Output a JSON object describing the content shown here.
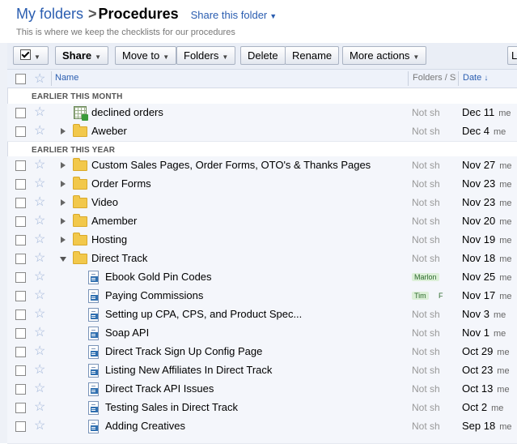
{
  "header": {
    "breadcrumb_root": "My folders",
    "separator": ">",
    "current_folder": "Procedures",
    "share_folder_label": "Share this folder",
    "description": "This is where we keep the checklists for our procedures"
  },
  "toolbar": {
    "share": "Share",
    "move_to": "Move to",
    "folders": "Folders",
    "delete": "Delete",
    "rename": "Rename",
    "more_actions": "More actions",
    "partial_button": "L"
  },
  "columns": {
    "name": "Name",
    "folders_shared": "Folders / Sh",
    "date": "Date",
    "sort_arrow": "↓"
  },
  "sections": {
    "this_month": "EARLIER THIS MONTH",
    "this_year": "EARLIER THIS YEAR"
  },
  "rows": [
    {
      "name": "declined orders",
      "share": "Not sh",
      "date": "Dec 11",
      "who": "me"
    },
    {
      "name": "Aweber",
      "share": "Not sh",
      "date": "Dec 4",
      "who": "me"
    },
    {
      "name": "Custom Sales Pages, Order Forms, OTO's & Thanks Pages",
      "share": "Not sh",
      "date": "Nov 27",
      "who": "me"
    },
    {
      "name": "Order Forms",
      "share": "Not sh",
      "date": "Nov 23",
      "who": "me"
    },
    {
      "name": "Video",
      "share": "Not sh",
      "date": "Nov 23",
      "who": "me"
    },
    {
      "name": "Amember",
      "share": "Not sh",
      "date": "Nov 20",
      "who": "me"
    },
    {
      "name": "Hosting",
      "share": "Not sh",
      "date": "Nov 19",
      "who": "me"
    },
    {
      "name": "Direct Track",
      "share": "Not sh",
      "date": "Nov 18",
      "who": "me"
    },
    {
      "name": "Ebook Gold Pin Codes",
      "share": "Marlon",
      "date": "Nov 25",
      "who": "me"
    },
    {
      "name": "Paying Commissions",
      "share": "Tim",
      "share2": "F",
      "date": "Nov 17",
      "who": "me"
    },
    {
      "name": "Setting up CPA, CPS, and Product Spec...",
      "share": "Not sh",
      "date": "Nov 3",
      "who": "me"
    },
    {
      "name": "Soap API",
      "share": "Not sh",
      "date": "Nov 1",
      "who": "me"
    },
    {
      "name": "Direct Track Sign Up Config Page",
      "share": "Not sh",
      "date": "Oct 29",
      "who": "me"
    },
    {
      "name": "Listing New Affiliates In Direct Track",
      "share": "Not sh",
      "date": "Oct 23",
      "who": "me"
    },
    {
      "name": "Direct Track API Issues",
      "share": "Not sh",
      "date": "Oct 13",
      "who": "me"
    },
    {
      "name": "Testing Sales in Direct Track",
      "share": "Not sh",
      "date": "Oct 2",
      "who": "me"
    },
    {
      "name": "Adding Creatives",
      "share": "Not sh",
      "date": "Sep 18",
      "who": "me"
    }
  ]
}
